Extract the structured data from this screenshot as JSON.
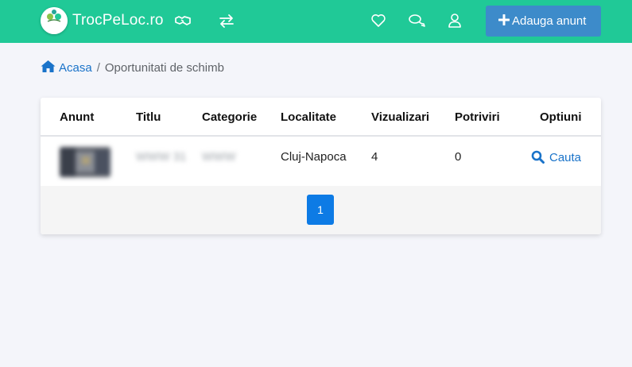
{
  "app": {
    "brand": "TrocPeLoc.ro",
    "logo_text": "TrocPeLoc"
  },
  "navbar": {
    "icons": [
      "handshake-icon",
      "exchange-icon",
      "heart-icon",
      "comments-icon",
      "user-icon"
    ],
    "add_button_label": "Adauga anunt"
  },
  "breadcrumb": {
    "home_label": "Acasa",
    "separator": "/",
    "current": "Oportunitati de schimb"
  },
  "table": {
    "headers": {
      "ad": "Anunt",
      "title": "Titlu",
      "category": "Categorie",
      "location": "Localitate",
      "views": "Vizualizari",
      "matches": "Potriviri",
      "options": "Optiuni"
    },
    "rows": [
      {
        "title": "WWW 31",
        "category": "WWW",
        "location": "Cluj-Napoca",
        "views": "4",
        "matches": "0",
        "action_label": "Cauta"
      }
    ]
  },
  "pagination": {
    "current_page": "1"
  },
  "colors": {
    "navbar": "#20c997",
    "add_button": "#3d8bca",
    "link": "#1a73c9",
    "page_active": "#0d7be5",
    "background": "#f4f5fa"
  }
}
